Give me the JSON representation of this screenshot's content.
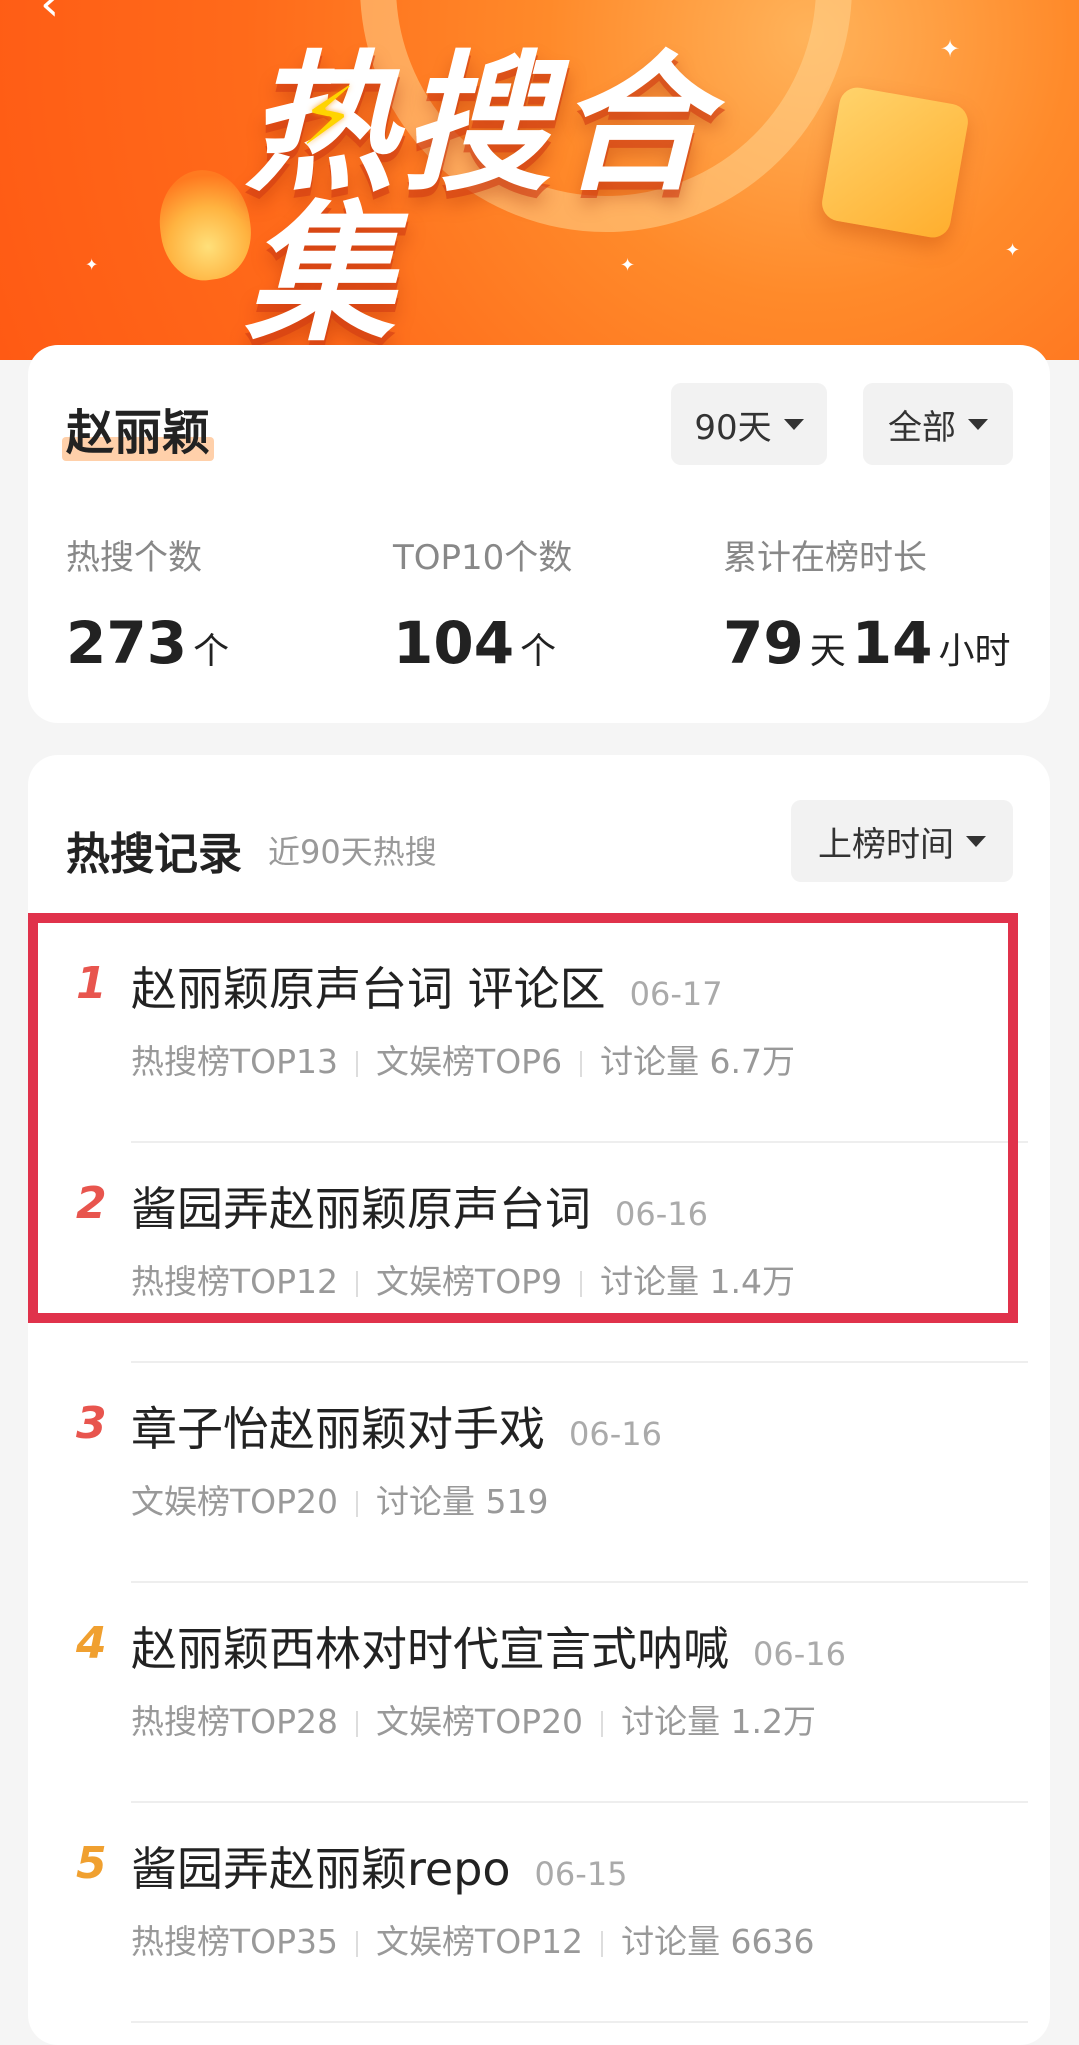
{
  "banner": {
    "title": "热搜合集"
  },
  "summary": {
    "name": "赵丽颖",
    "filter_period": "90天",
    "filter_scope": "全部",
    "stats": [
      {
        "label": "热搜个数",
        "value": "273",
        "unit": "个"
      },
      {
        "label": "TOP10个数",
        "value": "104",
        "unit": "个"
      },
      {
        "label": "累计在榜时长",
        "value1": "79",
        "unit1": "天",
        "value2": "14",
        "unit2": "小时"
      }
    ]
  },
  "records": {
    "title": "热搜记录",
    "subtitle": "近90天热搜",
    "sort_label": "上榜时间",
    "items": [
      {
        "rank": "1",
        "title": "赵丽颖原声台词 评论区",
        "date": "06-17",
        "meta": [
          "热搜榜TOP13",
          "文娱榜TOP6",
          "讨论量 6.7万"
        ],
        "rank_color": "#e8554e"
      },
      {
        "rank": "2",
        "title": "酱园弄赵丽颖原声台词",
        "date": "06-16",
        "meta": [
          "热搜榜TOP12",
          "文娱榜TOP9",
          "讨论量 1.4万"
        ],
        "rank_color": "#e8554e"
      },
      {
        "rank": "3",
        "title": "章子怡赵丽颖对手戏",
        "date": "06-16",
        "meta": [
          "文娱榜TOP20",
          "讨论量 519"
        ],
        "rank_color": "#e8554e"
      },
      {
        "rank": "4",
        "title": "赵丽颖西林对时代宣言式呐喊",
        "date": "06-16",
        "meta": [
          "热搜榜TOP28",
          "文娱榜TOP20",
          "讨论量 1.2万"
        ],
        "rank_color": "#f0a030"
      },
      {
        "rank": "5",
        "title": "酱园弄赵丽颖repo",
        "date": "06-15",
        "meta": [
          "热搜榜TOP35",
          "文娱榜TOP12",
          "讨论量 6636"
        ],
        "rank_color": "#f0a030"
      }
    ]
  }
}
